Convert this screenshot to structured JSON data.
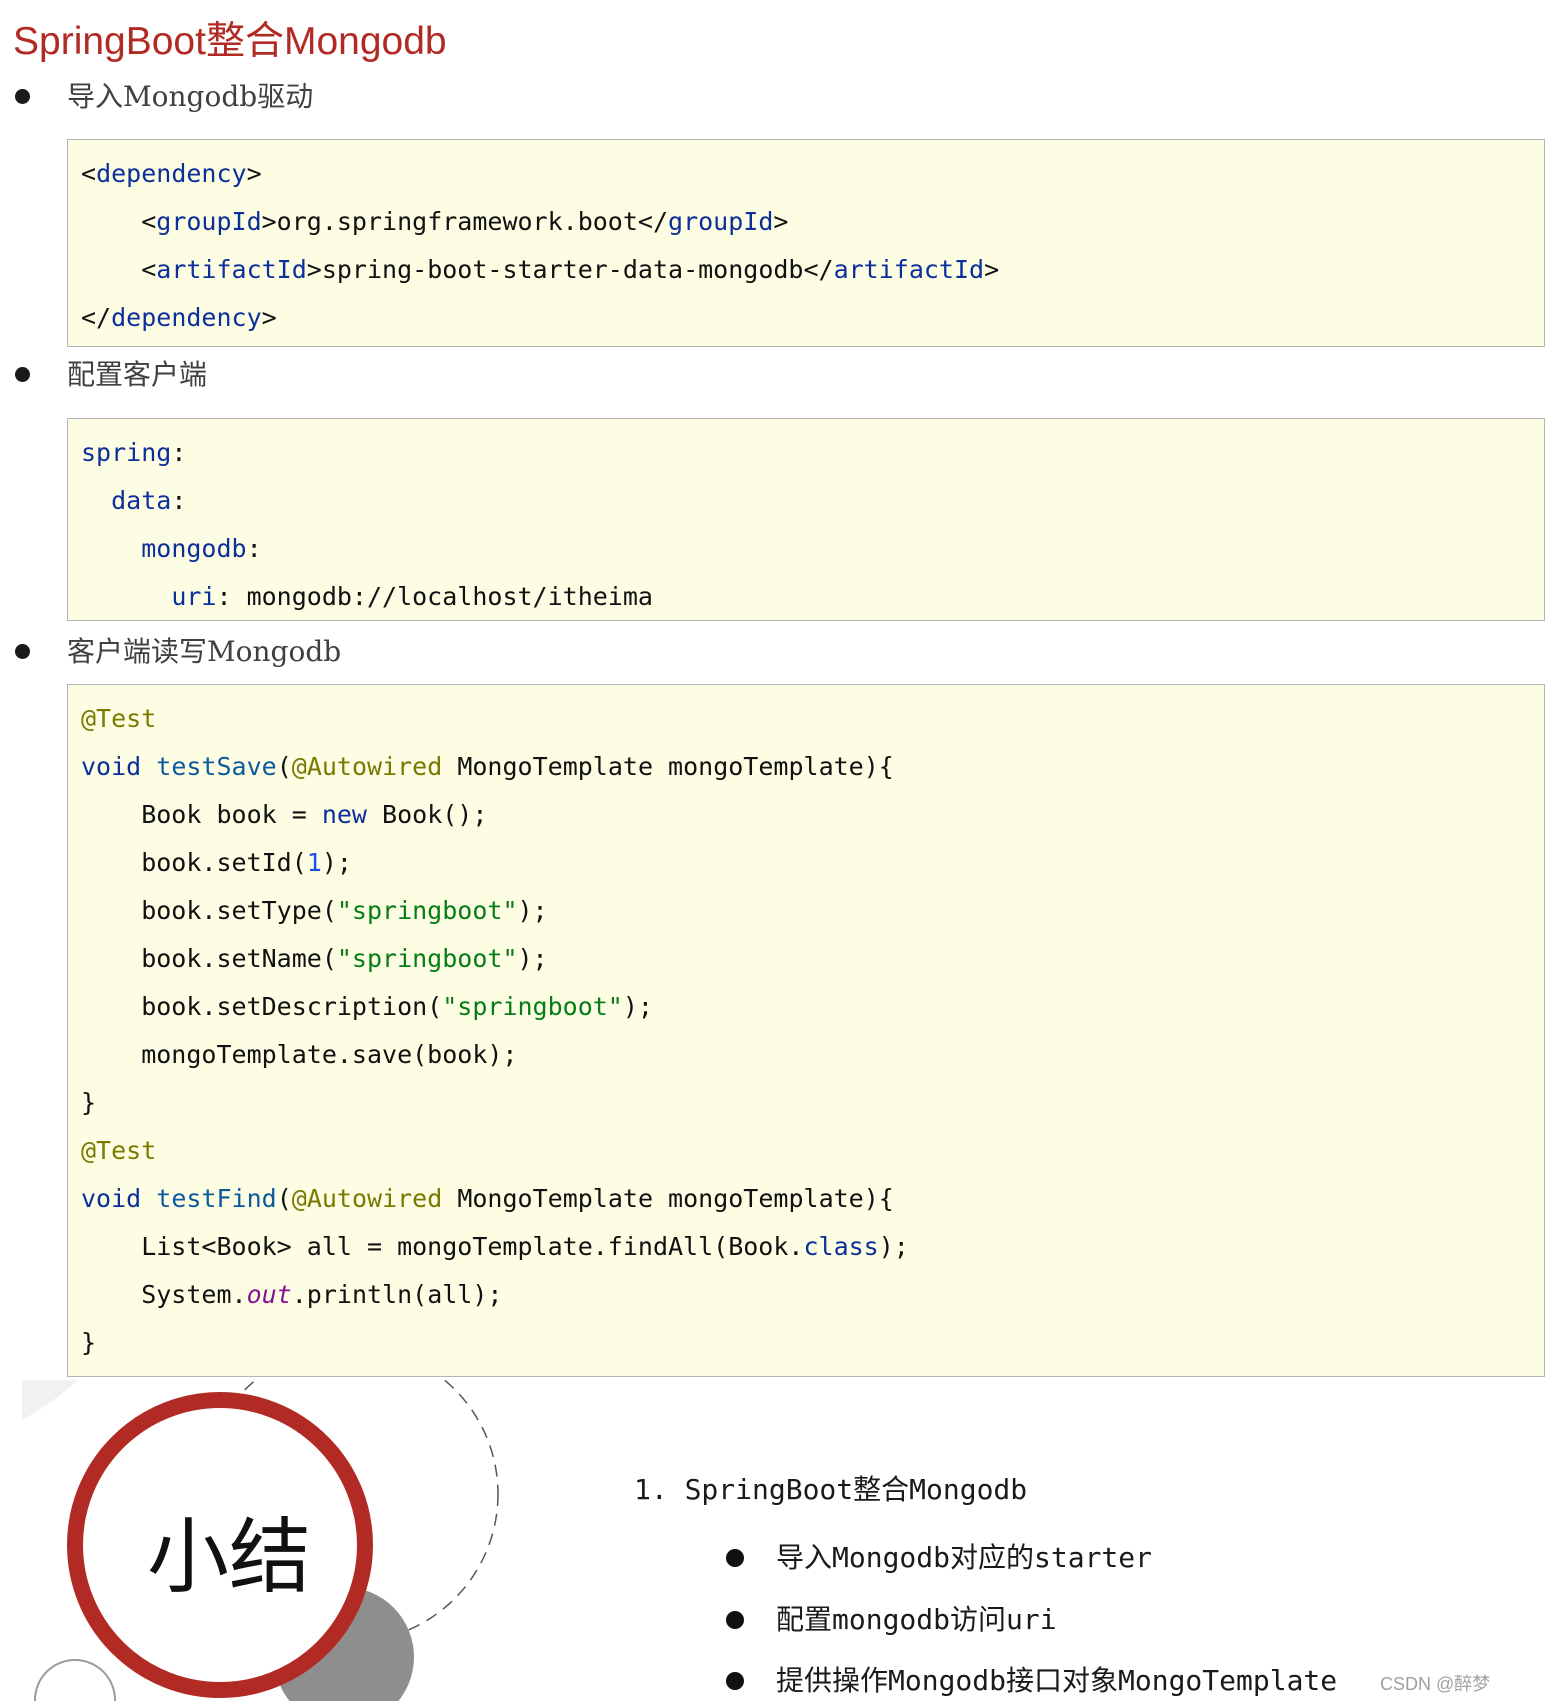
{
  "title": "SpringBoot整合Mongodb",
  "sections": [
    {
      "bullet": "导入Mongodb驱动",
      "code": [
        [
          {
            "t": "<",
            "c": ""
          },
          {
            "t": "dependency",
            "c": "tag"
          },
          {
            "t": ">",
            "c": ""
          }
        ],
        [
          {
            "t": "    <",
            "c": ""
          },
          {
            "t": "groupId",
            "c": "tag"
          },
          {
            "t": ">org.springframework.boot</",
            "c": ""
          },
          {
            "t": "groupId",
            "c": "tag"
          },
          {
            "t": ">",
            "c": ""
          }
        ],
        [
          {
            "t": "    <",
            "c": ""
          },
          {
            "t": "artifactId",
            "c": "tag"
          },
          {
            "t": ">spring-boot-starter-data-mongodb</",
            "c": ""
          },
          {
            "t": "artifactId",
            "c": "tag"
          },
          {
            "t": ">",
            "c": ""
          }
        ],
        [
          {
            "t": "</",
            "c": ""
          },
          {
            "t": "dependency",
            "c": "tag"
          },
          {
            "t": ">",
            "c": ""
          }
        ]
      ]
    },
    {
      "bullet": "配置客户端",
      "code": [
        [
          {
            "t": "spring",
            "c": "key"
          },
          {
            "t": ":",
            "c": ""
          }
        ],
        [
          {
            "t": "  ",
            "c": ""
          },
          {
            "t": "data",
            "c": "key"
          },
          {
            "t": ":",
            "c": ""
          }
        ],
        [
          {
            "t": "    ",
            "c": ""
          },
          {
            "t": "mongodb",
            "c": "key"
          },
          {
            "t": ":",
            "c": ""
          }
        ],
        [
          {
            "t": "      ",
            "c": ""
          },
          {
            "t": "uri",
            "c": "key"
          },
          {
            "t": ": mongodb://localhost/itheima",
            "c": ""
          }
        ]
      ]
    },
    {
      "bullet": "客户端读写Mongodb",
      "code": [
        [
          {
            "t": "@Test",
            "c": "anno"
          }
        ],
        [
          {
            "t": "void",
            "c": "kw"
          },
          {
            "t": " ",
            "c": ""
          },
          {
            "t": "testSave",
            "c": "fn"
          },
          {
            "t": "(",
            "c": ""
          },
          {
            "t": "@Autowired",
            "c": "anno"
          },
          {
            "t": " MongoTemplate mongoTemplate){",
            "c": ""
          }
        ],
        [
          {
            "t": "    Book book = ",
            "c": ""
          },
          {
            "t": "new",
            "c": "kw"
          },
          {
            "t": " Book();",
            "c": ""
          }
        ],
        [
          {
            "t": "    book.setId(",
            "c": ""
          },
          {
            "t": "1",
            "c": "num"
          },
          {
            "t": ");",
            "c": ""
          }
        ],
        [
          {
            "t": "    book.setType(",
            "c": ""
          },
          {
            "t": "\"springboot\"",
            "c": "str"
          },
          {
            "t": ");",
            "c": ""
          }
        ],
        [
          {
            "t": "    book.setName(",
            "c": ""
          },
          {
            "t": "\"springboot\"",
            "c": "str"
          },
          {
            "t": ");",
            "c": ""
          }
        ],
        [
          {
            "t": "    book.setDescription(",
            "c": ""
          },
          {
            "t": "\"springboot\"",
            "c": "str"
          },
          {
            "t": ");",
            "c": ""
          }
        ],
        [
          {
            "t": "    mongoTemplate.save(book);",
            "c": ""
          }
        ],
        [
          {
            "t": "}",
            "c": ""
          }
        ],
        [
          {
            "t": "@Test",
            "c": "anno"
          }
        ],
        [
          {
            "t": "void",
            "c": "kw"
          },
          {
            "t": " ",
            "c": ""
          },
          {
            "t": "testFind",
            "c": "fn"
          },
          {
            "t": "(",
            "c": ""
          },
          {
            "t": "@Autowired",
            "c": "anno"
          },
          {
            "t": " MongoTemplate mongoTemplate){",
            "c": ""
          }
        ],
        [
          {
            "t": "    List<Book> all = mongoTemplate.findAll(Book.",
            "c": ""
          },
          {
            "t": "class",
            "c": "kw"
          },
          {
            "t": ");",
            "c": ""
          }
        ],
        [
          {
            "t": "    System.",
            "c": ""
          },
          {
            "t": "out",
            "c": "static"
          },
          {
            "t": ".println(all);",
            "c": ""
          }
        ],
        [
          {
            "t": "}",
            "c": ""
          }
        ]
      ]
    }
  ],
  "summary": {
    "badge": "小结",
    "heading": "1. SpringBoot整合Mongodb",
    "items": [
      "导入Mongodb对应的starter",
      "配置mongodb访问uri",
      "提供操作Mongodb接口对象MongoTemplate"
    ]
  },
  "watermark": "CSDN @醉梦",
  "colors": {
    "title": "#b22a24",
    "code_bg": "#fdfde3",
    "ring": "#b22a24",
    "gray_circle": "#8e8e8e"
  }
}
